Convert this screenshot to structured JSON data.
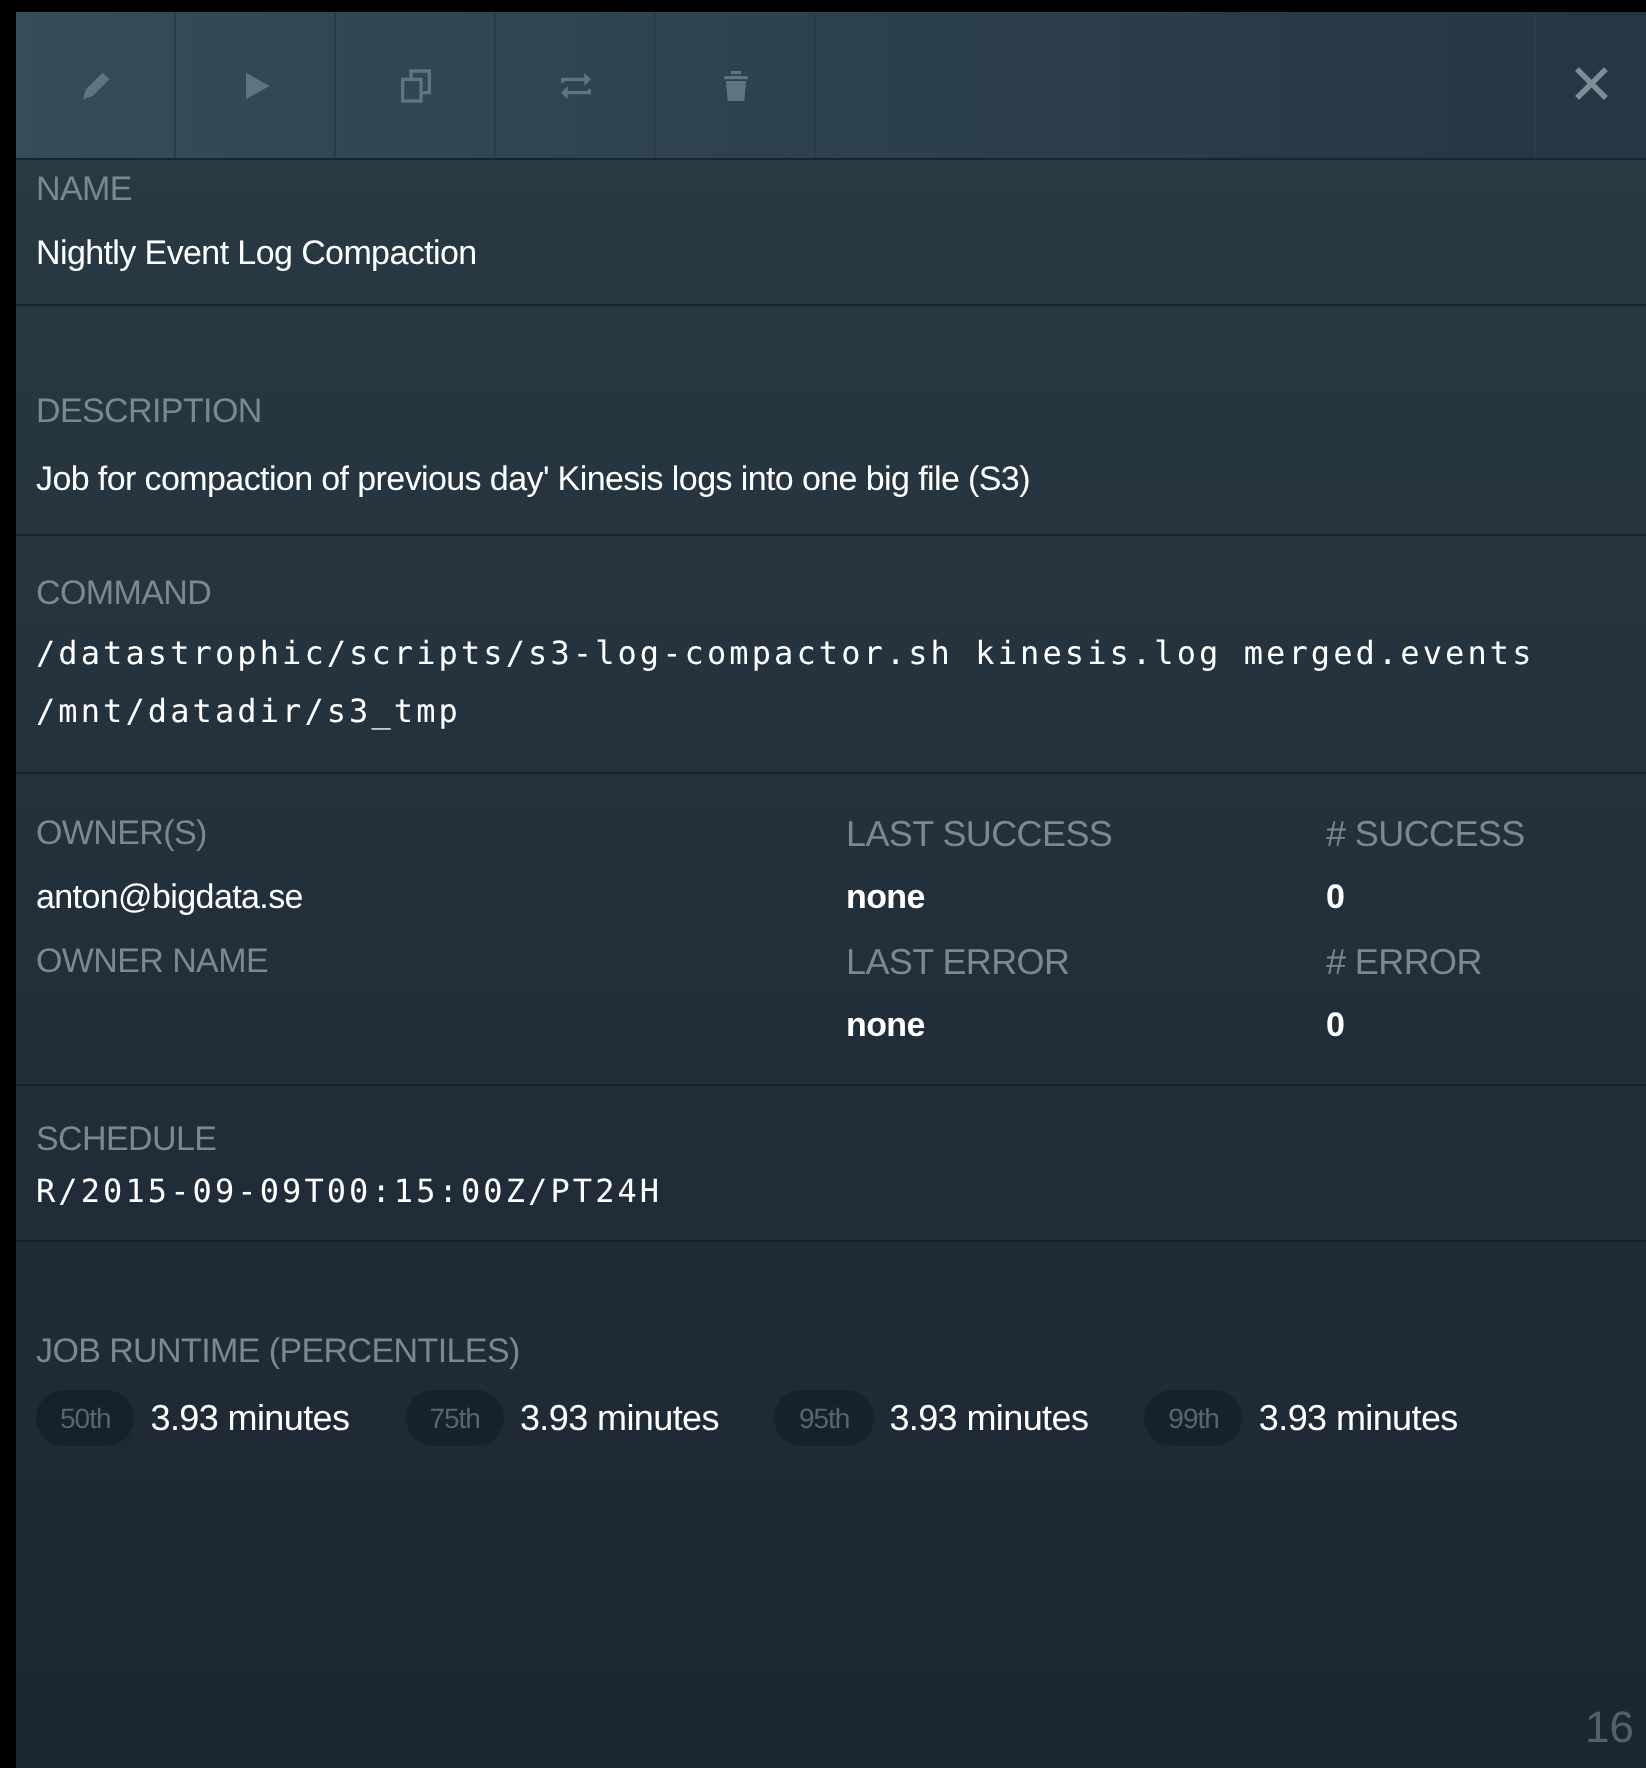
{
  "toolbar": {
    "buttons": [
      {
        "kind": "edit"
      },
      {
        "kind": "run"
      },
      {
        "kind": "copy"
      },
      {
        "kind": "repeat"
      },
      {
        "kind": "delete"
      }
    ],
    "close": {
      "label": "✕"
    }
  },
  "name": {
    "label": "NAME",
    "value": "Nightly Event Log Compaction"
  },
  "description": {
    "label": "DESCRIPTION",
    "value": "Job for compaction of previous day' Kinesis logs into one big file (S3)"
  },
  "command": {
    "label": "COMMAND",
    "lines": [
      "/datastrophic/scripts/s3-log-compactor.sh kinesis.log merged.events",
      "/mnt/datadir/s3_tmp"
    ]
  },
  "owners": {
    "label": "OWNER(S)",
    "value": "anton@bigdata.se",
    "name_label": "OWNER NAME"
  },
  "stats": [
    {
      "label": "LAST SUCCESS",
      "value": "none"
    },
    {
      "label": "# SUCCESS",
      "value": "0"
    },
    {
      "label": "LAST ERROR",
      "value": "none"
    },
    {
      "label": "# ERROR",
      "value": "0"
    }
  ],
  "schedule": {
    "label": "SCHEDULE",
    "value": "R/2015-09-09T00:15:00Z/PT24H"
  },
  "runtime": {
    "label": "JOB RUNTIME (PERCENTILES)",
    "percentiles": [
      {
        "badge": "50th",
        "value": "3.93 minutes"
      },
      {
        "badge": "75th",
        "value": "3.93 minutes"
      },
      {
        "badge": "95th",
        "value": "3.93 minutes"
      },
      {
        "badge": "99th",
        "value": "3.93 minutes"
      }
    ]
  },
  "page_number": "16"
}
